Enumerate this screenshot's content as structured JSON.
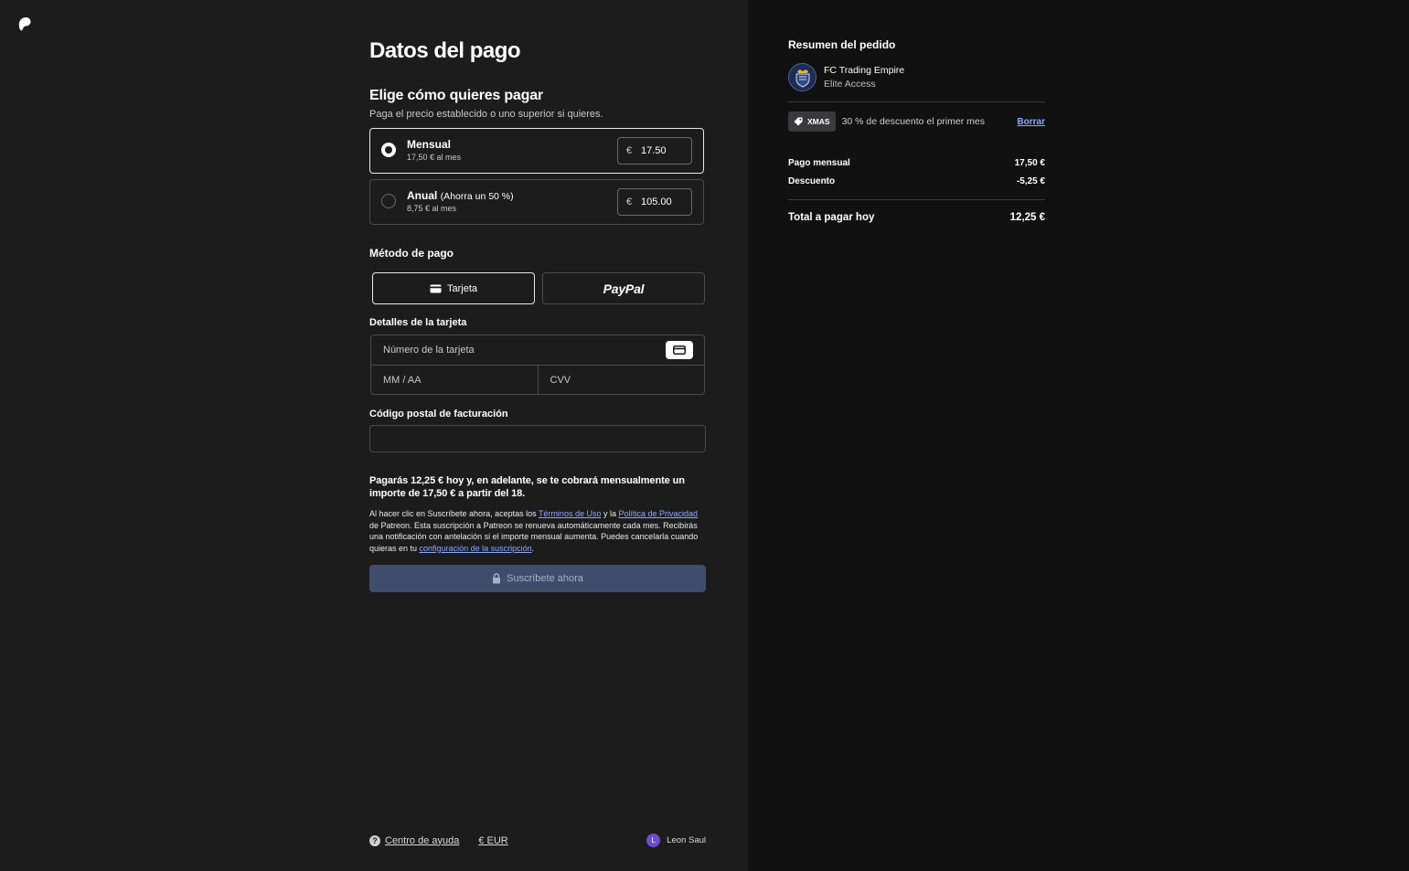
{
  "page": {
    "title": "Datos del pago",
    "logo_icon": "patreon-logo-icon"
  },
  "pricing": {
    "heading": "Elige cómo quieres pagar",
    "subheading": "Paga el precio establecido o uno superior si quieres.",
    "options": [
      {
        "name": "Mensual",
        "note": "",
        "sub": "17,50 € al mes",
        "currency": "€",
        "amount": "17.50",
        "selected": true
      },
      {
        "name": "Anual",
        "note": "(Ahorra un 50 %)",
        "sub": "8,75 € al mes",
        "currency": "€",
        "amount": "105.00",
        "selected": false
      }
    ]
  },
  "payment_method": {
    "heading": "Método de pago",
    "card_label": "Tarjeta",
    "paypal_label": "PayPal",
    "selected": "card"
  },
  "card": {
    "heading": "Detalles de la tarjeta",
    "number_placeholder": "Número de la tarjeta",
    "expiry_placeholder": "MM / AA",
    "cvv_placeholder": "CVV"
  },
  "postal": {
    "heading": "Código postal de facturación",
    "value": ""
  },
  "notice": "Pagarás 12,25 € hoy y, en adelante, se te cobrará mensualmente un importe de 17,50 € a partir del 18.",
  "legal": {
    "part1": "Al hacer clic en Suscríbete ahora, aceptas los ",
    "terms_link": "Términos de Uso",
    "part2": " y la ",
    "privacy_link": "Política de Privacidad",
    "part3": " de Patreon. Esta suscripción a Patreon se renueva automáticamente cada mes. Recibirás una notificación con antelación si el importe mensual aumenta. Puedes cancelarla cuando quieras en tu ",
    "settings_link": "configuración de la suscripción",
    "part4": "."
  },
  "submit_label": "Suscríbete ahora",
  "footer": {
    "help": "Centro de ayuda",
    "currency": "€ EUR",
    "user_initial": "L",
    "user_name": "Leon Saul"
  },
  "summary": {
    "title": "Resumen del pedido",
    "creator_name": "FC Trading Empire",
    "tier": "Elite Access",
    "promo_code": "XMAS",
    "promo_text": "30 % de descuento el primer mes",
    "promo_remove": "Borrar",
    "rows": [
      {
        "label": "Pago mensual",
        "value": "17,50 €"
      },
      {
        "label": "Descuento",
        "value": "-5,25 €"
      }
    ],
    "total_label": "Total a pagar hoy",
    "total_value": "12,25 €"
  },
  "colors": {
    "background": "#1c1c1d",
    "summary_background": "#111111",
    "link": "#8fa9ff",
    "button_disabled": "#3e4d6b"
  }
}
